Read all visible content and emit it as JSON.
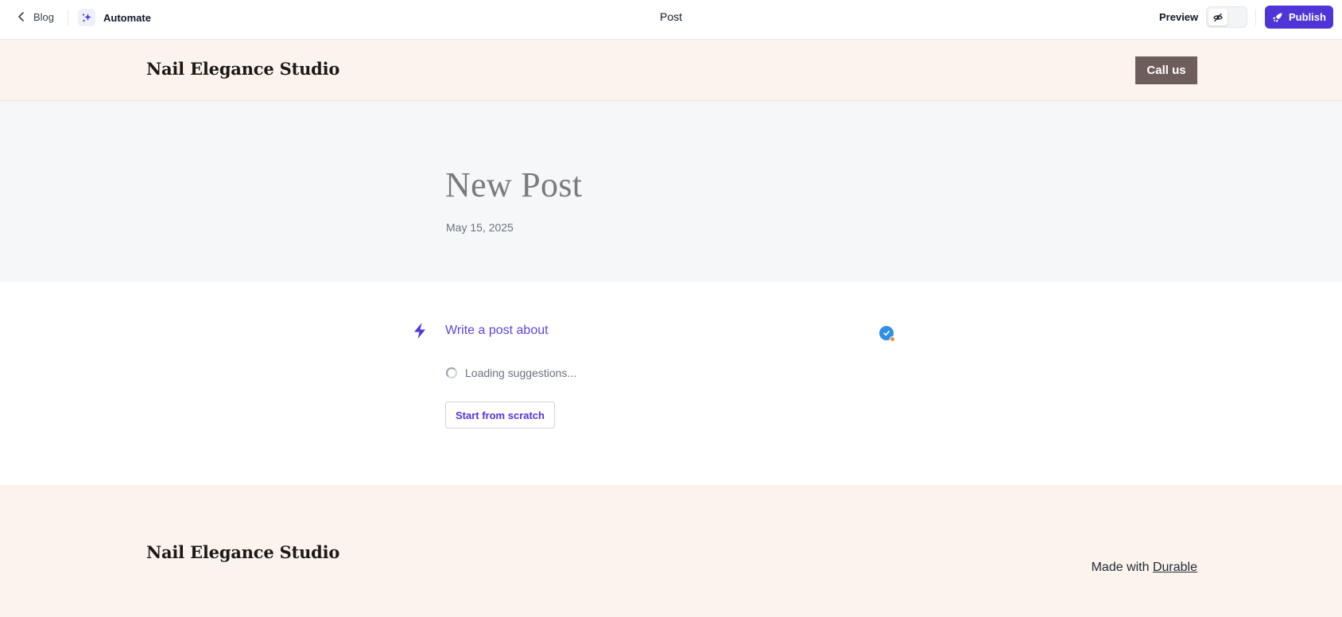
{
  "topbar": {
    "back_label": "Blog",
    "automate_label": "Automate",
    "page_name": "Post",
    "preview_label": "Preview",
    "publish_label": "Publish",
    "accent_color": "#4f35d8"
  },
  "site_header": {
    "logo": "Nail Elegance Studio",
    "cta_label": "Call us",
    "background": "#fcf3ec"
  },
  "hero": {
    "title": "New Post",
    "date": "May 15, 2025"
  },
  "composer": {
    "prompt_placeholder": "Write a post about",
    "loading_text": "Loading suggestions...",
    "scratch_label": "Start from scratch"
  },
  "footer": {
    "logo": "Nail Elegance Studio",
    "made_with_prefix": "Made with",
    "made_with_link": "Durable"
  },
  "icons": {
    "back": "chevron-left-icon",
    "automate": "sparkle-icon",
    "preview": "eye-off-icon",
    "publish": "rocket-icon",
    "prompt": "lightning-bolt-icon",
    "loading": "spinner-icon",
    "grammar": "check-badge-icon"
  }
}
